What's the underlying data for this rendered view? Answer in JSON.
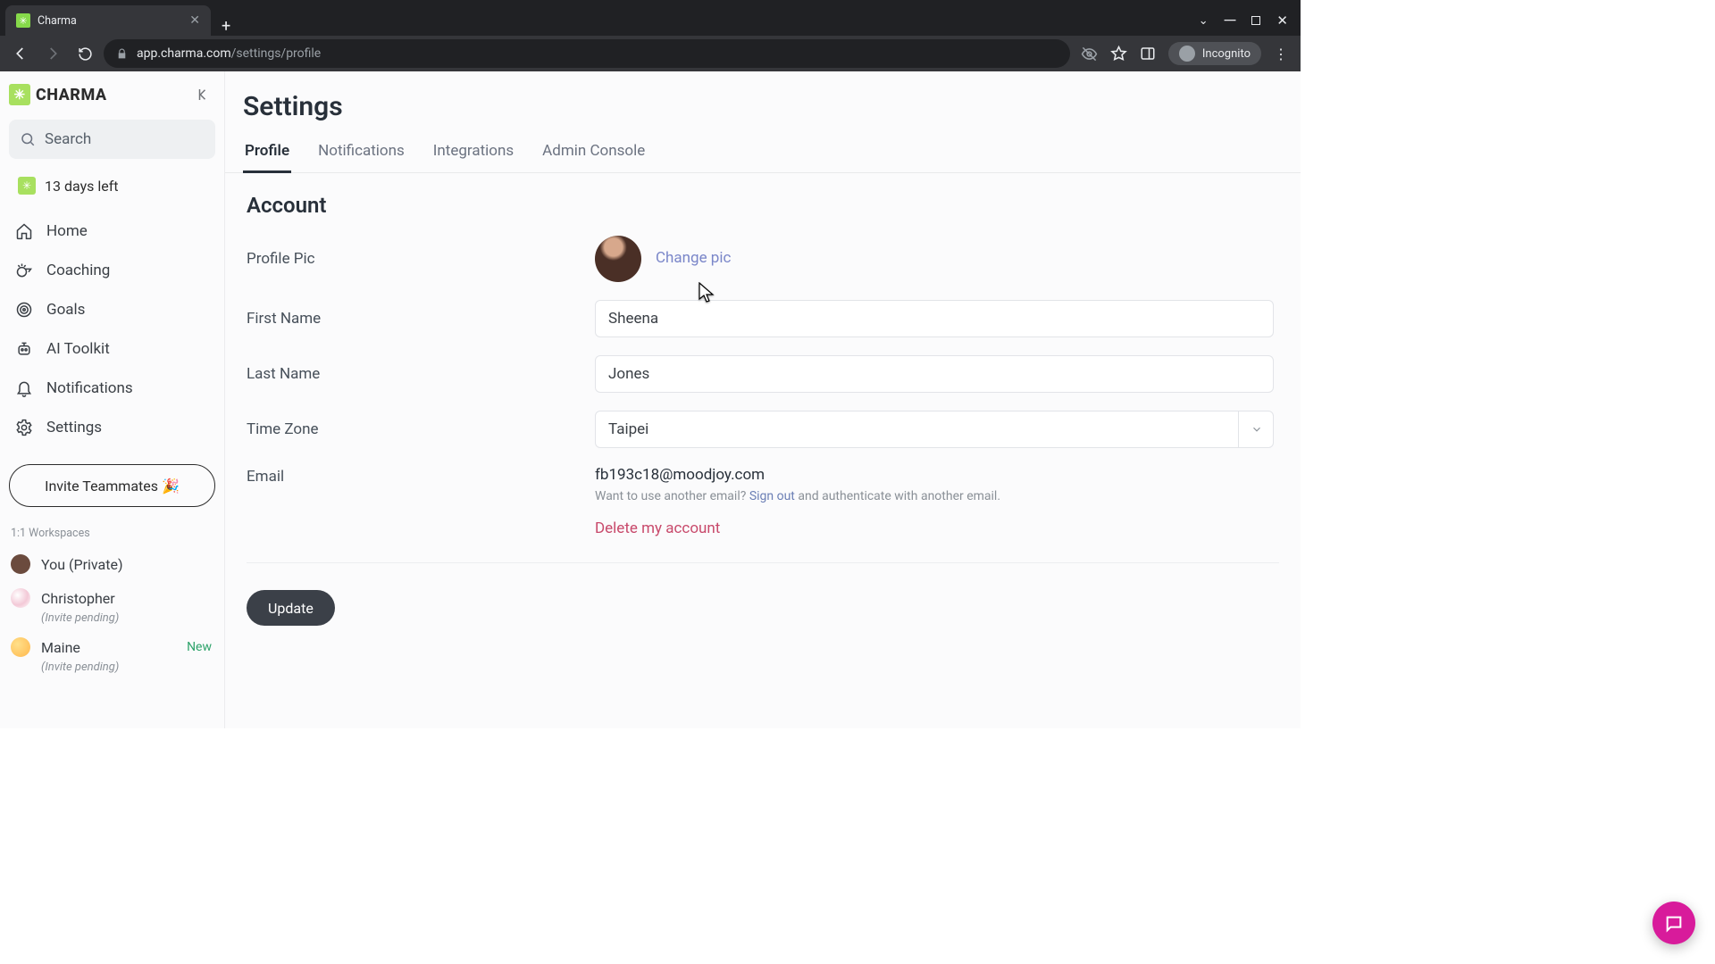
{
  "browser": {
    "tab_title": "Charma",
    "url_host": "app.charma.com",
    "url_path": "/settings/profile",
    "incognito_label": "Incognito"
  },
  "sidebar": {
    "brand": "CHARMA",
    "search_placeholder": "Search",
    "trial_text": "13 days left",
    "nav": [
      {
        "label": "Home"
      },
      {
        "label": "Coaching"
      },
      {
        "label": "Goals"
      },
      {
        "label": "AI Toolkit"
      },
      {
        "label": "Notifications"
      },
      {
        "label": "Settings"
      }
    ],
    "invite_label": "Invite Teammates 🎉",
    "workspaces_heading": "1:1 Workspaces",
    "workspaces": [
      {
        "label": "You (Private)",
        "pending": "",
        "tag": ""
      },
      {
        "label": "Christopher",
        "pending": "(Invite pending)",
        "tag": ""
      },
      {
        "label": "Maine",
        "pending": "(Invite pending)",
        "tag": "New"
      }
    ]
  },
  "page": {
    "title": "Settings",
    "tabs": [
      {
        "label": "Profile",
        "active": true
      },
      {
        "label": "Notifications",
        "active": false
      },
      {
        "label": "Integrations",
        "active": false
      },
      {
        "label": "Admin Console",
        "active": false
      }
    ],
    "account": {
      "heading": "Account",
      "profile_pic_label": "Profile Pic",
      "change_pic": "Change pic",
      "first_name_label": "First Name",
      "first_name_value": "Sheena",
      "last_name_label": "Last Name",
      "last_name_value": "Jones",
      "timezone_label": "Time Zone",
      "timezone_value": "Taipei",
      "email_label": "Email",
      "email_value": "fb193c18@moodjoy.com",
      "email_note_pre": "Want to use another email? ",
      "email_note_link": "Sign out",
      "email_note_post": " and authenticate with another email.",
      "delete_account": "Delete my account",
      "update_button": "Update"
    }
  }
}
